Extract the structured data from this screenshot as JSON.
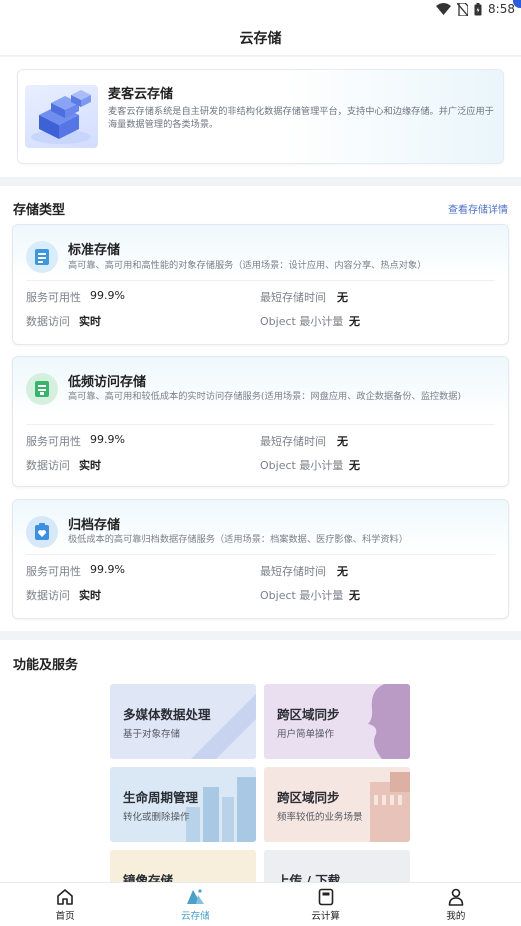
{
  "status_bar": {
    "time": "8:58"
  },
  "header": {
    "title": "云存储"
  },
  "intro": {
    "title": "麦客云存储",
    "description": "麦客云存储系统是自主研发的非结构化数据存储管理平台，支持中心和边缘存储。并广泛应用于海量数据管理的各类场景。"
  },
  "storage": {
    "section_title": "存储类型",
    "detail_link": "查看存储详情",
    "cards": [
      {
        "name": "标准存储",
        "description": "高可靠、高可用和高性能的对象存储服务（适用场景：设计应用、内容分享、热点对象）",
        "availability_label": "服务可用性",
        "availability_value": "99.9%",
        "min_time_label": "最短存储时间",
        "min_time_value": "无",
        "access_label": "数据访问",
        "access_value": "实时",
        "min_object_label": "Object 最小计量",
        "min_object_value": "无"
      },
      {
        "name": "低频访问存储",
        "description": "高可靠、高可用和较低成本的实时访问存储服务(适用场景：网盘应用、政企数据备份、监控数据)",
        "availability_label": "服务可用性",
        "availability_value": "99.9%",
        "min_time_label": "最短存储时间",
        "min_time_value": "无",
        "access_label": "数据访问",
        "access_value": "实时",
        "min_object_label": "Object 最小计量",
        "min_object_value": "无"
      },
      {
        "name": "归档存储",
        "description": "极低成本的高可靠归档数据存储服务（适用场景：档案数据、医疗影像、科学资料）",
        "availability_label": "服务可用性",
        "availability_value": "99.9%",
        "min_time_label": "最短存储时间",
        "min_time_value": "无",
        "access_label": "数据访问",
        "access_value": "实时",
        "min_object_label": "Object 最小计量",
        "min_object_value": "无"
      }
    ]
  },
  "functions": {
    "section_title": "功能及服务",
    "tiles": [
      {
        "title": "多媒体数据处理",
        "subtitle": "基于对象存储",
        "color": "#dfe6f6"
      },
      {
        "title": "跨区域同步",
        "subtitle": "用户简单操作",
        "color": "#eadff0"
      },
      {
        "title": "生命周期管理",
        "subtitle": "转化或删除操作",
        "color": "#d9e8f4"
      },
      {
        "title": "跨区域同步",
        "subtitle": "频率较低的业务场景",
        "color": "#f6e6e2"
      },
      {
        "title": "镜像存储",
        "subtitle": "",
        "color": "#f7efdc"
      },
      {
        "title": "上传 / 下载",
        "subtitle": "",
        "color": "#eceef2"
      }
    ]
  },
  "bottom_nav": {
    "items": [
      {
        "label": "首页",
        "icon": "home-icon"
      },
      {
        "label": "云存储",
        "icon": "cloud-storage-icon",
        "active": true
      },
      {
        "label": "云计算",
        "icon": "cloud-compute-icon"
      },
      {
        "label": "我的",
        "icon": "profile-icon"
      }
    ]
  },
  "colors": {
    "accent": "#4aa0c6",
    "link": "#4d6fc9"
  }
}
